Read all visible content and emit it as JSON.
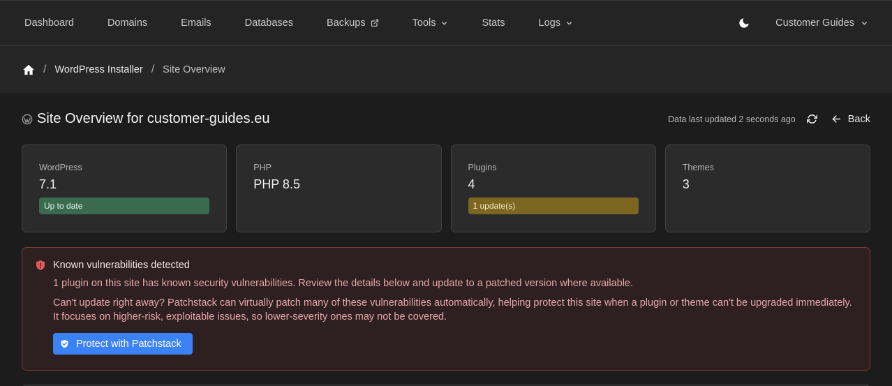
{
  "nav": {
    "items": [
      {
        "label": "Dashboard"
      },
      {
        "label": "Domains"
      },
      {
        "label": "Emails"
      },
      {
        "label": "Databases"
      },
      {
        "label": "Backups"
      },
      {
        "label": "Tools"
      },
      {
        "label": "Stats"
      },
      {
        "label": "Logs"
      }
    ],
    "account_label": "Customer Guides"
  },
  "breadcrumb": {
    "items": [
      {
        "label": "WordPress Installer"
      },
      {
        "label": "Site Overview"
      }
    ],
    "separator": "/"
  },
  "header": {
    "title": "Site Overview for customer-guides.eu",
    "updated_text": "Data last updated 2 seconds ago",
    "back_label": "Back"
  },
  "cards": [
    {
      "label": "WordPress",
      "value": "7.1",
      "badge": "Up to date",
      "badge_color": "#3a6b4f"
    },
    {
      "label": "PHP",
      "value": "PHP 8.5"
    },
    {
      "label": "Plugins",
      "value": "4",
      "badge": "1 update(s)",
      "badge_color": "#7d6620"
    },
    {
      "label": "Themes",
      "value": "3"
    }
  ],
  "alert": {
    "title": "Known vulnerabilities detected",
    "text1": "1 plugin on this site has known security vulnerabilities. Review the details below and update to a patched version where available.",
    "text2": "Can't update right away? Patchstack can virtually patch many of these vulnerabilities automatically, helping protect this site when a plugin or theme can't be upgraded immediately. It focuses on higher-risk, exploitable issues, so lower-severity ones may not be covered.",
    "button_label": "Protect with Patchstack",
    "accent_color": "#e05a5a"
  },
  "colors": {
    "primary": "#3b82f6",
    "background": "#1c1c1c",
    "surface": "#2b2b2b"
  },
  "icons": {
    "external": "external-link-icon",
    "chevron": "chevron-down-icon",
    "theme": "moon-icon",
    "home": "home-icon",
    "wordpress": "wordpress-icon",
    "refresh": "refresh-icon",
    "back": "arrow-left-icon",
    "alert": "shield-alert-icon",
    "button": "shield-check-icon"
  }
}
